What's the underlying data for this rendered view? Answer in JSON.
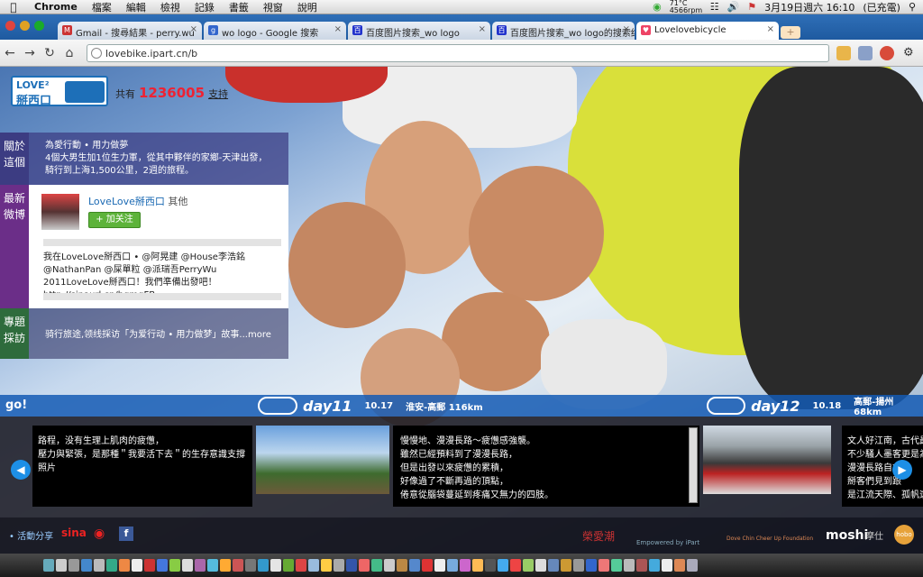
{
  "menubar": {
    "app": "Chrome",
    "items": [
      "檔案",
      "編輯",
      "檢視",
      "記錄",
      "書籤",
      "視窗",
      "說明"
    ],
    "weather": "71°C 4566rpm",
    "datetime": "3月19日週六  16:10",
    "battery": "(已充電)"
  },
  "tabs": [
    {
      "title": "Gmail - 搜尋結果 - perry.wu",
      "favicon": "gmail-icon",
      "color": "#c33"
    },
    {
      "title": "wo logo - Google 搜索",
      "favicon": "google-icon",
      "color": "#36c"
    },
    {
      "title": "百度图片搜索_wo logo",
      "favicon": "baidu-icon",
      "color": "#23c"
    },
    {
      "title": "百度图片搜索_wo logo的搜索结",
      "favicon": "baidu-icon",
      "color": "#23c"
    },
    {
      "title": "Lovelovebicycle",
      "favicon": "love-icon",
      "color": "#e46"
    }
  ],
  "newtab": "+",
  "toolbar": {
    "url": "lovebike.ipart.cn/b"
  },
  "site": {
    "logo_top": "LOVE²",
    "logo_bottom": "掰西口",
    "counter_prefix": "共有",
    "counter_value": "1236005",
    "counter_suffix": "支持"
  },
  "leftnav": [
    {
      "label": "關於\n這個",
      "color": "#3c3c82"
    },
    {
      "label": "最新\n微博",
      "color": "#6b2e88"
    },
    {
      "label": "專題\n採訪",
      "color": "#2e6b3c"
    }
  ],
  "about": {
    "line1": "為愛行動 • 用力做夢",
    "line2": "4個大男生加1位生力軍，從其中夥伴的家鄉-天津出發，",
    "line3": "騎行到上海1,500公里，2週的旅程。"
  },
  "weibo": {
    "name": "LoveLove掰西口",
    "other": "其他",
    "follow": "+ 加关注",
    "text": "我在LoveLove掰西口 • @阿晃建 @House李浩銘 @NathanPan @屎單粒 @派瑞吾PerryWu 2011LoveLove掰西口！我們準備出發吧！ http://sinaurl.cn/hqmgFB"
  },
  "more": {
    "text": "骑行旅途,领线採访「为爱行动 • 用力做梦」故事...more"
  },
  "timeline": {
    "go": "go!",
    "days": [
      {
        "day": "day11",
        "date": "10.17",
        "route": "淮安-高郵 116km"
      },
      {
        "day": "day12",
        "date": "10.18",
        "route": "高郵-揚州 68km"
      }
    ]
  },
  "cards": [
    {
      "lines": [
        "路程，没有生理上肌肉的疲憊，",
        "壓力與緊張，是那種＂我要活下去＂的生存意識支撐",
        "照片"
      ]
    },
    {
      "lines": [
        "慢慢地、漫漫長路～疲憊感強襲。",
        "雖然已經預料到了漫漫長路，",
        "但是出發以來疲憊的累積，",
        "好像過了不斷再過的頂點，",
        "倦意從腦袋蔓延到疼痛又無力的四肢。"
      ]
    },
    {
      "lines": [
        "文人好江南，古代最",
        "不少騷人墨客更是為江",
        "漫漫長路自古皆",
        "掰客們見到跟",
        "是江流天際、孤帆遠"
      ]
    }
  ],
  "footer": {
    "share": "• 活動分享",
    "sina": "sina",
    "fb": "f",
    "sponsors": [
      "榮愛潮",
      "Empowered by iPart",
      "Dove Chin Cheer Up Foundation",
      "moshi",
      "摩仕",
      "hobo"
    ]
  },
  "colors": {
    "accent": "#1d6fb8",
    "timeline": "#1a5fb4",
    "counter": "#e22233"
  }
}
